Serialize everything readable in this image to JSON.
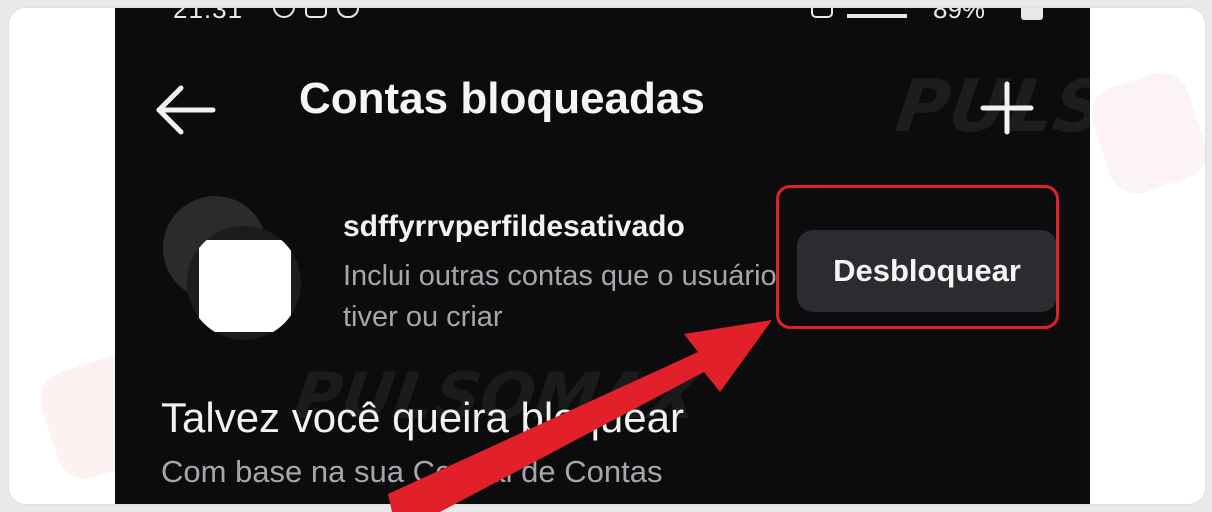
{
  "status_bar": {
    "time": "21:31",
    "battery_text": "89%"
  },
  "header": {
    "back_icon": "arrow-left-icon",
    "title": "Contas bloqueadas",
    "add_icon": "plus-icon"
  },
  "blocked_accounts": [
    {
      "username": "sdffyrrvperfildesativado",
      "description": "Inclui outras contas que o usuário tiver ou criar",
      "action_label": "Desbloquear"
    }
  ],
  "suggestions": {
    "title": "Talvez você queira bloquear",
    "subtitle": "Com base na sua Central de Contas"
  },
  "watermark": {
    "brand": "PULSOMAX"
  },
  "annotation": {
    "highlight_color": "#e2202a",
    "arrow_color": "#e2202a"
  },
  "colors": {
    "background": "#0c0c0e",
    "button": "#2c2c30",
    "text_primary": "#f5f5f5",
    "text_secondary": "#a7a7ab"
  }
}
